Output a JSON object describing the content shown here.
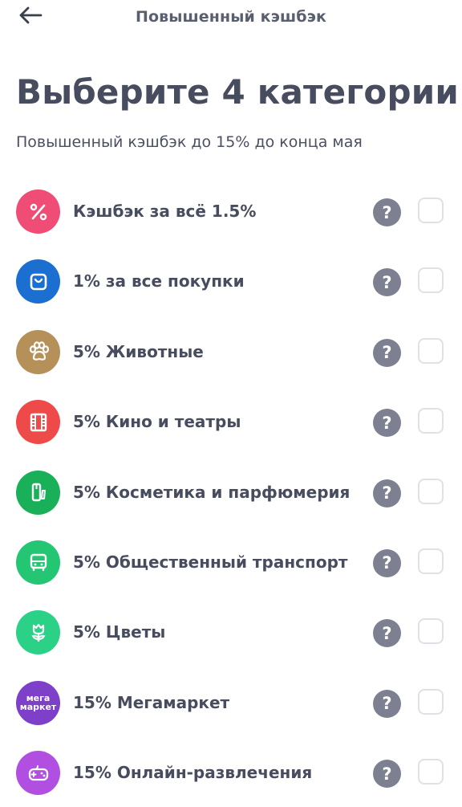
{
  "header": {
    "title": "Повышенный кэшбэк",
    "back_icon": "arrow-left-icon"
  },
  "main": {
    "title": "Выберите 4 категории",
    "subtitle": "Повышенный кэшбэк до 15% до конца мая"
  },
  "categories": [
    {
      "label": "Кэшбэк за всё 1.5%",
      "icon": "percent-icon",
      "color": "#ef4d75",
      "checked": false
    },
    {
      "label": "1% за все покупки",
      "icon": "shopping-bag-icon",
      "color": "#1a6fd1",
      "checked": false
    },
    {
      "label": "5% Животные",
      "icon": "paw-icon",
      "color": "#b59159",
      "checked": false
    },
    {
      "label": "5% Кино и театры",
      "icon": "film-icon",
      "color": "#ef4a4a",
      "checked": false
    },
    {
      "label": "5% Косметика и парфюмерия",
      "icon": "perfume-icon",
      "color": "#1ab05a",
      "checked": false
    },
    {
      "label": "5% Общественный транспорт",
      "icon": "bus-icon",
      "color": "#24c673",
      "checked": false
    },
    {
      "label": "5% Цветы",
      "icon": "flower-icon",
      "color": "#2bd187",
      "checked": false
    },
    {
      "label": "15% Мегамаркет",
      "icon": "megamarket-logo-icon",
      "logo_text_1": "мега",
      "logo_text_2": "маркет",
      "color": "#7e40c9",
      "checked": false
    },
    {
      "label": "15% Онлайн-развлечения",
      "icon": "gamepad-icon",
      "color": "#b04fe0",
      "checked": false
    }
  ],
  "help_label": "?",
  "colors": {
    "help_button": "#7c8090",
    "checkbox_border": "#dfe1e6",
    "text_primary": "#474c5e"
  }
}
